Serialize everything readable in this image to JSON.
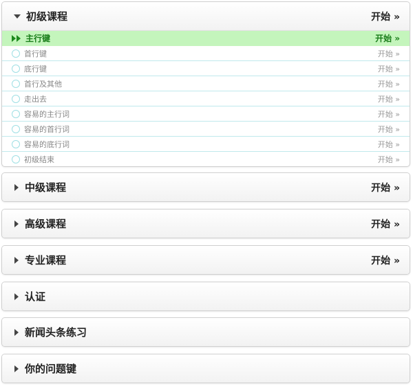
{
  "sections": [
    {
      "title": "初级课程",
      "start": "开始 »",
      "lessons": [
        {
          "label": "主行键",
          "start": "开始 »"
        },
        {
          "label": "首行键",
          "start": "开始 »"
        },
        {
          "label": "底行键",
          "start": "开始 »"
        },
        {
          "label": "首行及其他",
          "start": "开始 »"
        },
        {
          "label": "走出去",
          "start": "开始 »"
        },
        {
          "label": "容易的主行词",
          "start": "开始 »"
        },
        {
          "label": "容易的首行词",
          "start": "开始 »"
        },
        {
          "label": "容易的底行词",
          "start": "开始 »"
        },
        {
          "label": "初级结束",
          "start": "开始 »"
        }
      ]
    },
    {
      "title": "中级课程",
      "start": "开始 »"
    },
    {
      "title": "高级课程",
      "start": "开始 »"
    },
    {
      "title": "专业课程",
      "start": "开始 »"
    },
    {
      "title": "认证"
    },
    {
      "title": "新闻头条练习"
    },
    {
      "title": "你的问题键"
    }
  ],
  "colors": {
    "active_row_bg": "#c4f5bc",
    "active_text": "#1a7d1a",
    "row_divider": "#bfe9ec"
  },
  "icons": {
    "expanded": "triangle-down-icon",
    "collapsed": "triangle-right-icon",
    "current_lesson": "double-play-icon",
    "lesson_status": "empty-circle-icon"
  }
}
